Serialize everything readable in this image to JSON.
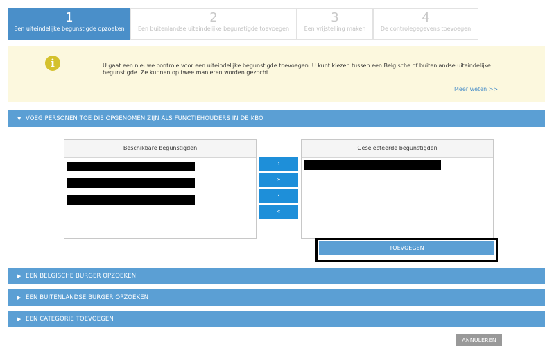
{
  "steps": [
    {
      "num": "1",
      "label": "Een uiteindelijke begunstigde opzoeken"
    },
    {
      "num": "2",
      "label": "Een buitenlandse uiteindelijke begunstigde toevoegen"
    },
    {
      "num": "3",
      "label": "Een vrijstelling maken"
    },
    {
      "num": "4",
      "label": "De controlegegevens toevoegen"
    }
  ],
  "info": {
    "icon": "info-icon",
    "text": "U gaat een nieuwe controle voor een uiteindelijke begunstigde toevoegen. U kunt kiezen tussen een Belgische of buitenlandse uiteindelijke begunstigde. Ze kunnen op twee manieren worden gezocht.",
    "link": "Meer weten >>"
  },
  "sections": {
    "kbo": "VOEG PERSONEN TOE DIE OPGENOMEN ZIJN ALS FUNCTIEHOUDERS IN DE KBO",
    "belgian": "EEN BELGISCHE BURGER OPZOEKEN",
    "foreign": "EEN BUITENLANDSE BURGER OPZOEKEN",
    "category": "EEN CATEGORIE TOEVOEGEN"
  },
  "available": {
    "header": "Beschikbare begunstigden"
  },
  "selected": {
    "header": "Geselecteerde begunstigden"
  },
  "move_buttons": {
    "add_one": "›",
    "add_all": "»",
    "remove_one": "‹",
    "remove_all": "«"
  },
  "toevoegen": "TOEVOEGEN",
  "annuleren": "ANNULEREN",
  "colors": {
    "accent": "#5b9fd4",
    "active_step": "#4a8fc9",
    "info_bg": "#fcf8de",
    "move_button": "#1e8fd9"
  }
}
